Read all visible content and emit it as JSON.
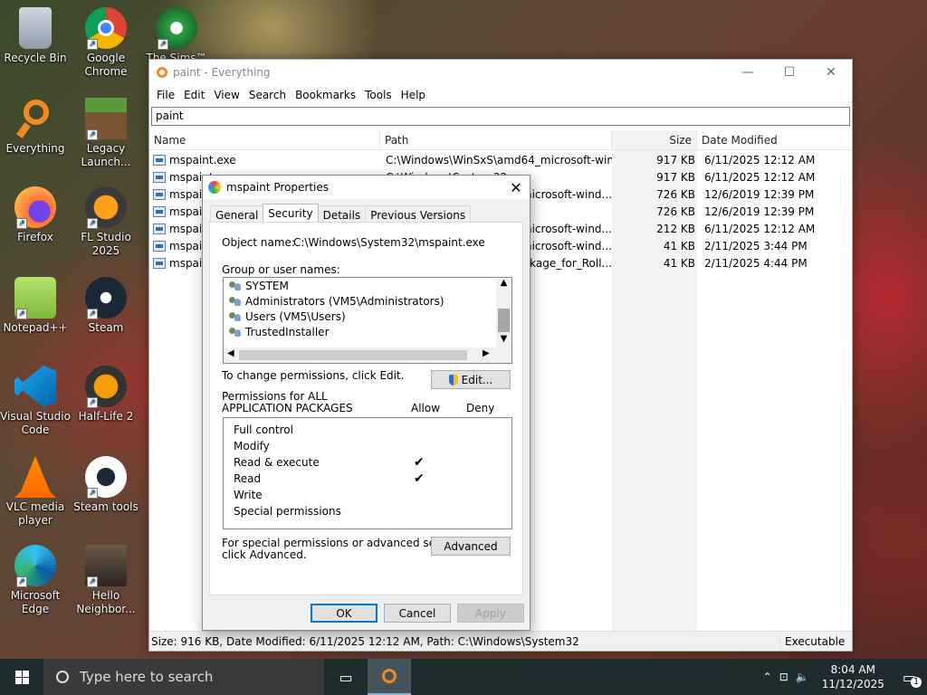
{
  "desktop": {
    "icons": [
      {
        "label": "Recycle Bin"
      },
      {
        "label": "Google Chrome"
      },
      {
        "label": "The Sims™ 4"
      },
      {
        "label": "Everything"
      },
      {
        "label": "Legacy Launch..."
      },
      {
        "label": "Firefox"
      },
      {
        "label": "FL Studio 2025"
      },
      {
        "label": "Notepad++"
      },
      {
        "label": "Steam"
      },
      {
        "label": "Visual Studio Code"
      },
      {
        "label": "Half-Life 2"
      },
      {
        "label": "VLC media player"
      },
      {
        "label": "Steam tools"
      },
      {
        "label": "Microsoft Edge"
      },
      {
        "label": "Hello Neighbor..."
      }
    ]
  },
  "everything": {
    "title": "paint - Everything",
    "menu": [
      "File",
      "Edit",
      "View",
      "Search",
      "Bookmarks",
      "Tools",
      "Help"
    ],
    "search_value": "paint",
    "columns": [
      "Name",
      "Path",
      "Size",
      "Date Modified"
    ],
    "rows": [
      {
        "name": "mspaint.exe",
        "path": "C:\\Windows\\WinSxS\\amd64_microsoft-wind...",
        "size": "917 KB",
        "date": "6/11/2025 12:12 AM"
      },
      {
        "name": "mspaint.exe",
        "path": "C:\\Windows\\System32",
        "size": "917 KB",
        "date": "6/11/2025 12:12 AM"
      },
      {
        "name": "mspaint",
        "path": "microsoft-wind...",
        "size": "726 KB",
        "date": "12/6/2019 12:39 PM"
      },
      {
        "name": "mspaint",
        "path": "",
        "size": "726 KB",
        "date": "12/6/2019 12:39 PM"
      },
      {
        "name": "mspaint",
        "path": "microsoft-wind...",
        "size": "212 KB",
        "date": "6/11/2025 12:12 AM"
      },
      {
        "name": "mspaint",
        "path": "microsoft-wind...",
        "size": "41 KB",
        "date": "2/11/2025 3:44 PM"
      },
      {
        "name": "mspaint",
        "path": "ackage_for_Roll...",
        "size": "41 KB",
        "date": "2/11/2025 4:44 PM"
      }
    ],
    "status": "Size: 916 KB, Date Modified: 6/11/2025 12:12 AM, Path: C:\\Windows\\System32",
    "status_right": "Executable"
  },
  "dialog": {
    "title": "mspaint Properties",
    "tabs": [
      "General",
      "Security",
      "Details",
      "Previous Versions"
    ],
    "active_tab": "Security",
    "object_label": "Object name:",
    "object_value": "C:\\Windows\\System32\\mspaint.exe",
    "group_label": "Group or user names:",
    "users": [
      "SYSTEM",
      "Administrators (VM5\\Administrators)",
      "Users (VM5\\Users)",
      "TrustedInstaller"
    ],
    "change_text": "To change permissions, click Edit.",
    "edit_button": "Edit...",
    "perm_header_1": "Permissions for ALL",
    "perm_header_2": "APPLICATION PACKAGES",
    "allow": "Allow",
    "deny": "Deny",
    "permissions": [
      {
        "name": "Full control",
        "allow": ""
      },
      {
        "name": "Modify",
        "allow": ""
      },
      {
        "name": "Read & execute",
        "allow": "✔"
      },
      {
        "name": "Read",
        "allow": "✔"
      },
      {
        "name": "Write",
        "allow": ""
      },
      {
        "name": "Special permissions",
        "allow": ""
      }
    ],
    "special_text_1": "For special permissions or advanced settings,",
    "special_text_2": "click Advanced.",
    "advanced_button": "Advanced",
    "ok": "OK",
    "cancel": "Cancel",
    "apply": "Apply"
  },
  "taskbar": {
    "search_placeholder": "Type here to search",
    "time": "8:04 AM",
    "date": "11/12/2025",
    "notification_count": "1"
  }
}
